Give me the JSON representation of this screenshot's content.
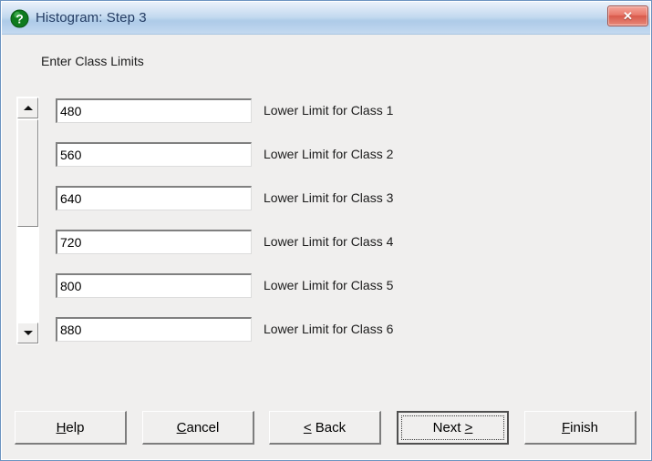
{
  "window": {
    "title": "Histogram: Step 3",
    "icon": "green-question-mark-icon",
    "close_label": "✕",
    "titlebar_gradient_top": "#e9f1fa",
    "titlebar_gradient_bottom": "#c5daf0",
    "close_button_color": "#d95a4c",
    "body_background": "#f0efee"
  },
  "content": {
    "header": "Enter Class Limits",
    "fields": [
      {
        "value": "480",
        "label": "Lower Limit for Class 1"
      },
      {
        "value": "560",
        "label": "Lower Limit for Class 2"
      },
      {
        "value": "640",
        "label": "Lower Limit for Class 3"
      },
      {
        "value": "720",
        "label": "Lower Limit for Class 4"
      },
      {
        "value": "800",
        "label": "Lower Limit for Class 5"
      },
      {
        "value": "880",
        "label": "Lower Limit for Class 6"
      }
    ]
  },
  "scrollbar": {
    "up_arrow": "scroll-up-arrow-icon",
    "down_arrow": "scroll-down-arrow-icon",
    "orientation": "vertical"
  },
  "buttons": {
    "help": {
      "text": "Help",
      "accel_before": "",
      "accel": "H",
      "accel_after": "elp"
    },
    "cancel": {
      "text": "Cancel",
      "accel_before": "",
      "accel": "C",
      "accel_after": "ancel"
    },
    "back": {
      "text": "< Back",
      "accel_before": "",
      "accel": "<",
      "accel_after": " Back"
    },
    "next": {
      "text": "Next >",
      "accel_before": "Next ",
      "accel": ">",
      "accel_after": ""
    },
    "finish": {
      "text": "Finish",
      "accel_before": "",
      "accel": "F",
      "accel_after": "inish"
    }
  }
}
